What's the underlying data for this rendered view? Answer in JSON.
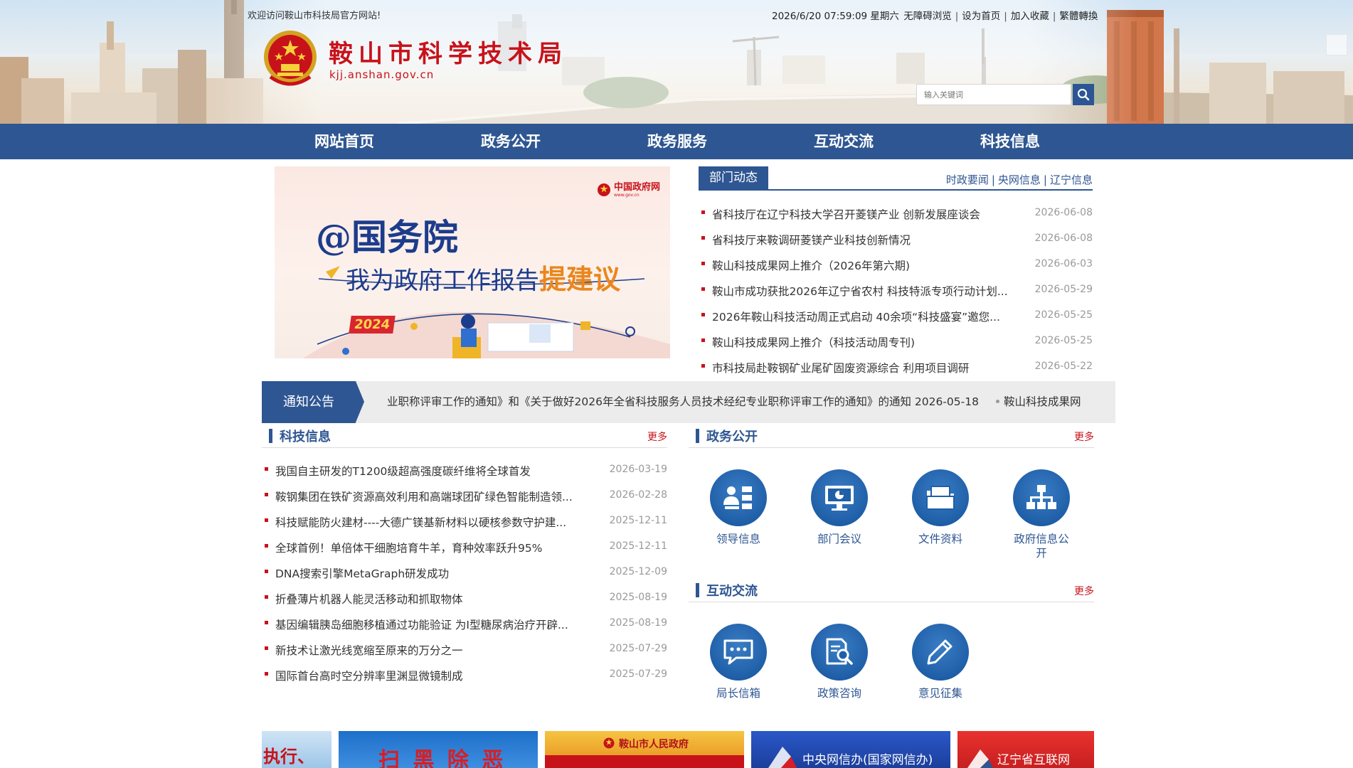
{
  "header": {
    "welcome": "欢迎访问鞍山市科技局官方网站!",
    "datetime": "2026/6/20 07:59:09 星期六",
    "links": [
      "无障碍浏览",
      "设为首页",
      "加入收藏",
      "繁體轉換"
    ],
    "title": "鞍山市科学技术局",
    "domain": "kjj.anshan.gov.cn",
    "search_placeholder": "输入关键词"
  },
  "nav": [
    "网站首页",
    "政务公开",
    "政务服务",
    "互动交流",
    "科技信息"
  ],
  "banner": {
    "logo": "中国政府网",
    "logo_sub": "www.gov.cn",
    "headline": "@国务院",
    "subline_prefix": "我为政府工作报告",
    "subline_highlight": "提建议",
    "year": "2024"
  },
  "dept_news": {
    "tab": "部门动态",
    "links": [
      "时政要闻",
      "央网信息",
      "辽宁信息"
    ],
    "items": [
      {
        "title": "省科技厅在辽宁科技大学召开菱镁产业 创新发展座谈会",
        "date": "2026-06-08"
      },
      {
        "title": "省科技厅来鞍调研菱镁产业科技创新情况",
        "date": "2026-06-08"
      },
      {
        "title": "鞍山科技成果网上推介（2026年第六期)",
        "date": "2026-06-03"
      },
      {
        "title": "鞍山市成功获批2026年辽宁省农村 科技特派专项行动计划...",
        "date": "2026-05-29"
      },
      {
        "title": "2026年鞍山科技活动周正式启动 40余项“科技盛宴”邀您...",
        "date": "2026-05-25"
      },
      {
        "title": "鞍山科技成果网上推介（科技活动周专刊)",
        "date": "2026-05-25"
      },
      {
        "title": "市科技局赴鞍钢矿业尾矿固废资源综合 利用项目调研",
        "date": "2026-05-22"
      }
    ]
  },
  "notice": {
    "label": "通知公告",
    "text": "业职称评审工作的通知》和《关于做好2026年全省科技服务人员技术经纪专业职称评审工作的通知》的通知 2026-05-18",
    "next": "鞍山科技成果网"
  },
  "tech_info": {
    "title": "科技信息",
    "more": "更多",
    "items": [
      {
        "title": "我国自主研发的T1200级超高强度碳纤维将全球首发",
        "date": "2026-03-19"
      },
      {
        "title": "鞍钢集团在铁矿资源高效利用和高端球团矿绿色智能制造领...",
        "date": "2026-02-28"
      },
      {
        "title": "科技赋能防火建材----大德广镁基新材料以硬核参数守护建...",
        "date": "2025-12-11"
      },
      {
        "title": "全球首例！单倍体干细胞培育牛羊，育种效率跃升95%",
        "date": "2025-12-11"
      },
      {
        "title": "DNA搜索引擎MetaGraph研发成功",
        "date": "2025-12-09"
      },
      {
        "title": "折叠薄片机器人能灵活移动和抓取物体",
        "date": "2025-08-19"
      },
      {
        "title": "基因编辑胰岛细胞移植通过功能验证 为Ⅰ型糖尿病治疗开辟...",
        "date": "2025-08-19"
      },
      {
        "title": "新技术让激光线宽缩至原来的万分之一",
        "date": "2025-07-29"
      },
      {
        "title": "国际首台高时空分辨率里渊显微镜制成",
        "date": "2025-07-29"
      }
    ]
  },
  "gov_open": {
    "title": "政务公开",
    "more": "更多",
    "items": [
      {
        "label": "领导信息",
        "icon": "leader-icon"
      },
      {
        "label": "部门会议",
        "icon": "meeting-icon"
      },
      {
        "label": "文件资料",
        "icon": "folder-icon"
      },
      {
        "label": "政府信息公开",
        "icon": "org-chart-icon"
      }
    ]
  },
  "interaction": {
    "title": "互动交流",
    "more": "更多",
    "items": [
      {
        "label": "局长信箱",
        "icon": "chat-icon"
      },
      {
        "label": "政策咨询",
        "icon": "document-search-icon"
      },
      {
        "label": "意见征集",
        "icon": "pencil-icon"
      }
    ]
  },
  "bottom_banners": [
    {
      "text": "执行、"
    },
    {
      "text": "扫 黑 除 恶"
    },
    {
      "text": "鞍山市人民政府"
    },
    {
      "text": "中央网信办(国家网信办)"
    },
    {
      "text": "辽宁省互联网"
    }
  ],
  "colors": {
    "brand_blue": "#2e5692",
    "brand_red": "#c8121a"
  }
}
